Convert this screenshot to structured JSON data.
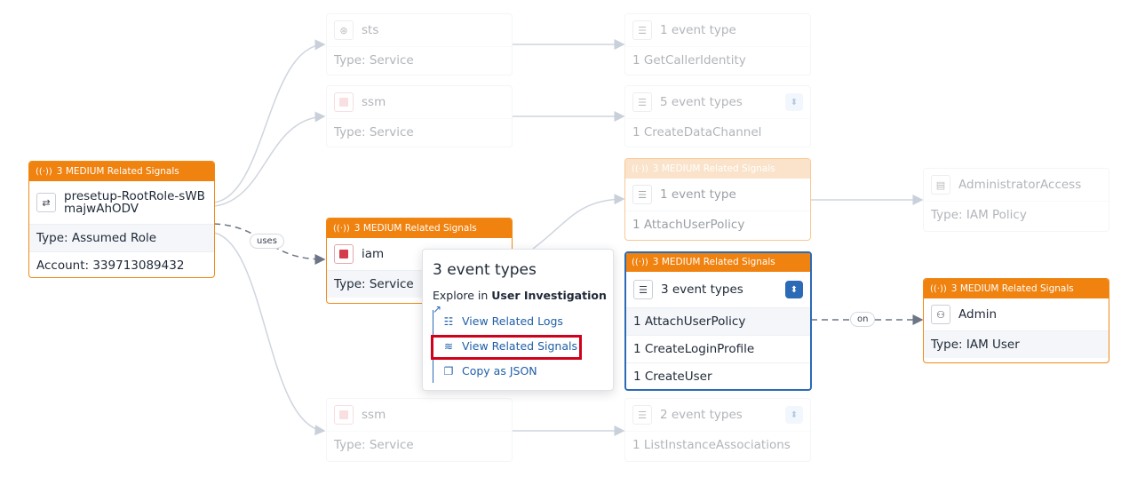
{
  "edge_labels": {
    "uses": "uses",
    "on": "on"
  },
  "source_node": {
    "banner": "3 MEDIUM Related Signals",
    "name": "presetup-RootRole-sWBmajwAhODV",
    "type": "Type: Assumed Role",
    "account": "Account: 339713089432",
    "icon": "swap-icon"
  },
  "iam_node": {
    "banner": "3 MEDIUM Related Signals",
    "name": "iam",
    "type": "Type: Service"
  },
  "sts_node": {
    "name": "sts",
    "type": "Type: Service"
  },
  "ssm_top_node": {
    "name": "ssm",
    "type": "Type: Service"
  },
  "ssm_bottom_node": {
    "name": "ssm",
    "type": "Type: Service"
  },
  "evt_getcaller": {
    "title": "1 event type",
    "item": "1 GetCallerIdentity"
  },
  "evt_createdata": {
    "title": "5 event types",
    "item": "1 CreateDataChannel"
  },
  "evt_attach": {
    "banner": "3 MEDIUM Related Signals",
    "title": "1 event type",
    "item": "1 AttachUserPolicy"
  },
  "evt_selected": {
    "banner": "3 MEDIUM Related Signals",
    "title": "3 event types",
    "items": [
      "1 AttachUserPolicy",
      "1 CreateLoginProfile",
      "1 CreateUser"
    ]
  },
  "evt_listinstance": {
    "title": "2 event types",
    "item": "1 ListInstanceAssociations"
  },
  "policy_node": {
    "name": "AdministratorAccess",
    "type": "Type: IAM Policy"
  },
  "admin_node": {
    "banner": "3 MEDIUM Related Signals",
    "name": "Admin",
    "type": "Type: IAM User"
  },
  "popup": {
    "title": "3 event types",
    "explore_prefix": "Explore in",
    "explore_target": "User Investigation",
    "items": [
      "View Related Logs",
      "View Related Signals",
      "Copy as JSON"
    ]
  },
  "colors": {
    "signal_orange": "#f0820f",
    "selected_blue": "#2b6ab6",
    "highlight_red": "#d0021b"
  }
}
